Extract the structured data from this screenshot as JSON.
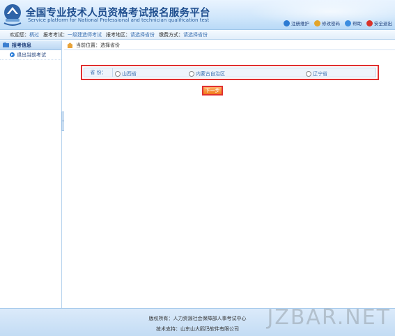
{
  "header": {
    "title_cn": "全国专业技术人员资格考试报名服务平台",
    "title_en": "Service platform for National Professional and technician qualification test",
    "links": [
      "注册维护",
      "修改密码",
      "帮助",
      "安全退出"
    ]
  },
  "infobar": {
    "welcome_label": "欢迎您：",
    "user": "柄过",
    "exam_label": "报考考试：",
    "exam_value": "一级建造师考试",
    "region_label": "报考地区：",
    "region_value": "请选择省份",
    "pay_label": "缴费方式：",
    "pay_value": "请选择省份"
  },
  "sidebar": {
    "head": "报考信息",
    "items": [
      "退出当前考试"
    ]
  },
  "main": {
    "crumb": "当前位置：选择省份",
    "province_label": "省 份：",
    "options": [
      "山西省",
      "内蒙古自治区",
      "辽宁省"
    ],
    "next_label": "下一步"
  },
  "footer": {
    "copyright": "版权所有：人力资源社会保障部人事考试中心",
    "support": "技术支持：山东山大鸥玛软件有限公司"
  },
  "watermark": "JZBAR.NET",
  "colors": {
    "accent": "#3a6fb0",
    "highlight": "#e03030",
    "button": "#f07a1a"
  }
}
